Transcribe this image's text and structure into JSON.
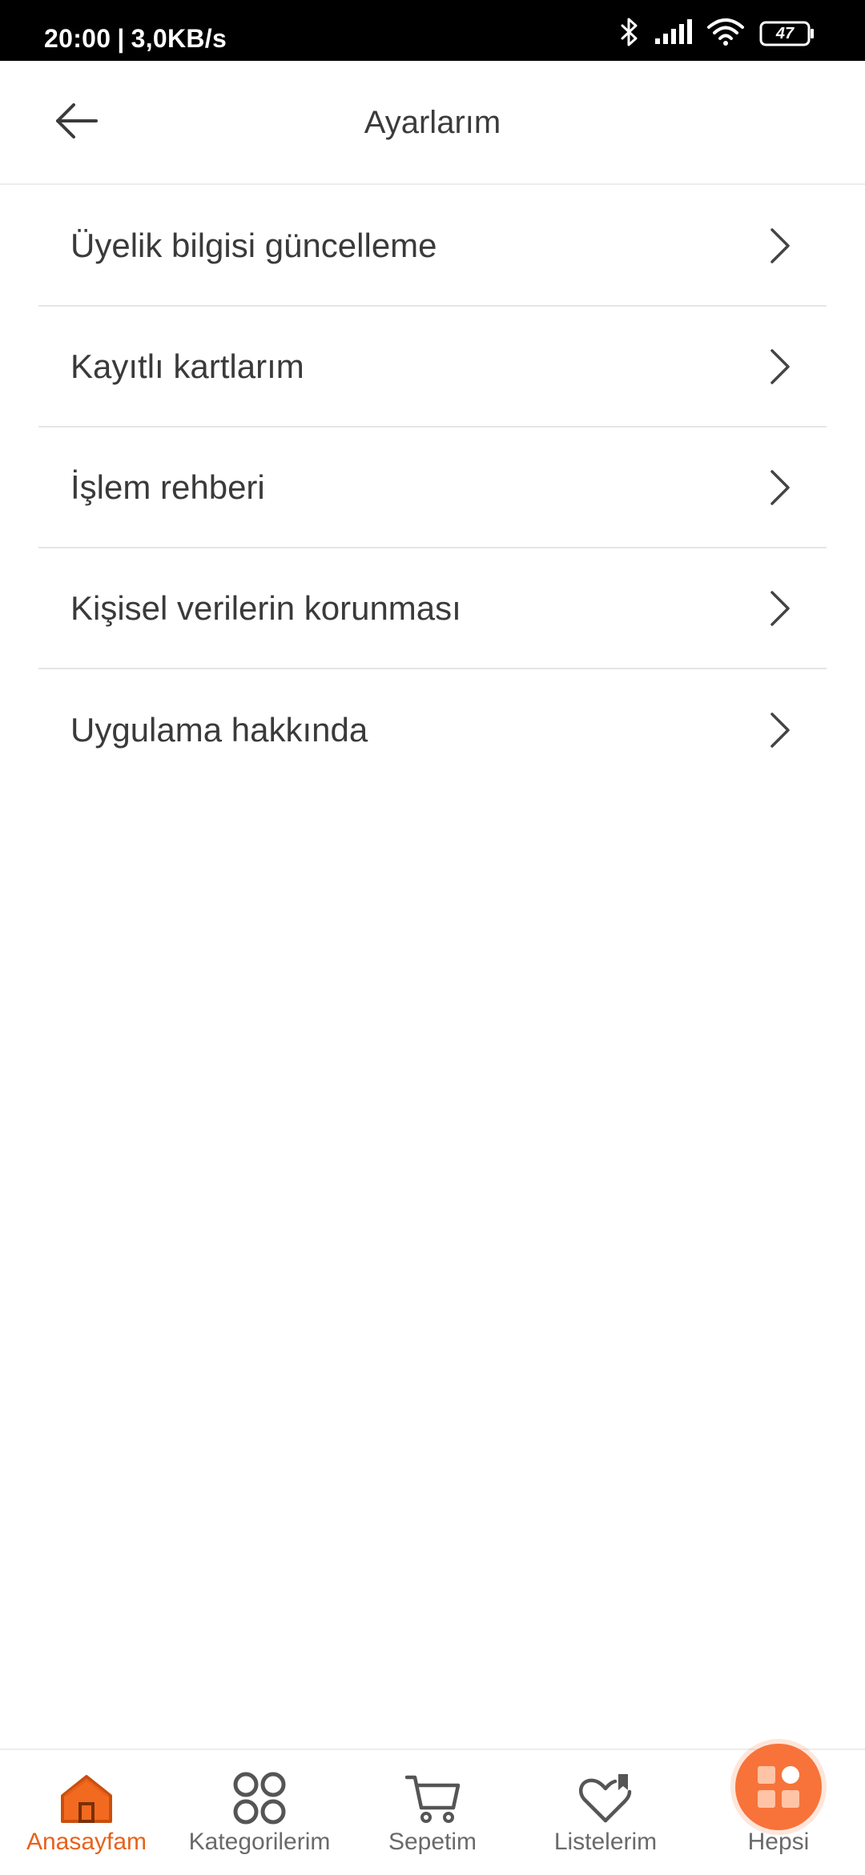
{
  "status_bar": {
    "time": "20:00",
    "separator": "|",
    "network_speed": "3,0KB/s",
    "battery_level": "47",
    "icons": [
      "bluetooth-icon",
      "signal-icon",
      "wifi-icon",
      "battery-icon"
    ]
  },
  "header": {
    "title": "Ayarlarım",
    "back_icon": "arrow-left-icon"
  },
  "settings": {
    "items": [
      {
        "label": "Üyelik bilgisi güncelleme"
      },
      {
        "label": "Kayıtlı kartlarım"
      },
      {
        "label": "İşlem rehberi"
      },
      {
        "label": "Kişisel verilerin korunması"
      },
      {
        "label": "Uygulama hakkında"
      }
    ],
    "chevron_icon": "chevron-right-icon"
  },
  "bottom_nav": {
    "items": [
      {
        "label": "Anasayfam",
        "icon": "home-icon",
        "active": true
      },
      {
        "label": "Kategorilerim",
        "icon": "categories-icon",
        "active": false
      },
      {
        "label": "Sepetim",
        "icon": "cart-icon",
        "active": false
      },
      {
        "label": "Listelerim",
        "icon": "heart-list-icon",
        "active": false
      },
      {
        "label": "Hepsi",
        "icon": "grid-apps-icon",
        "active": false
      }
    ]
  },
  "colors": {
    "accent": "#e8611a",
    "hepsi_button": "#f7733a",
    "status_bar_bg": "#000000",
    "text": "#3a3a3a",
    "divider": "#e6e6e6"
  }
}
